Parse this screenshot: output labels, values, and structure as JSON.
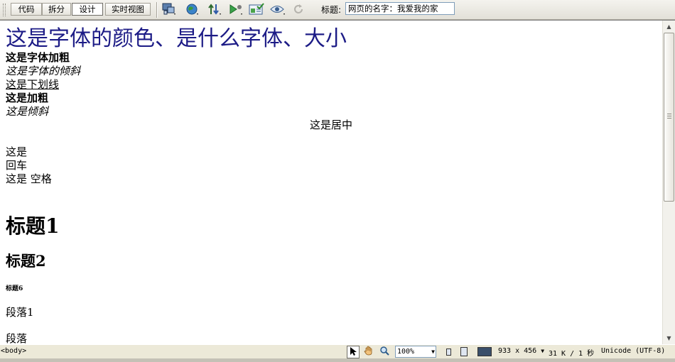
{
  "toolbar": {
    "code_label": "代码",
    "split_label": "拆分",
    "design_label": "设计",
    "live_view_label": "实时视图",
    "title_label": "标题:",
    "title_value": "网页的名字：我爱我的家",
    "icons": [
      "multiscreen-icon",
      "preview-browser-icon",
      "file-management-icon",
      "debug-icon",
      "visual-aids-icon",
      "view-options-icon",
      "refresh-icon"
    ]
  },
  "document": {
    "big_text": "这是字体的颜色、是什么字体、大小",
    "big_text_color": "#1c1b86",
    "bold_text": "这是字体加粗",
    "italic_text": "这是字体的倾斜",
    "underline_text": "这是下划线",
    "bold_text_2": "这是加粗",
    "italic_text_2": "这是倾斜",
    "center_text": "这是居中",
    "line_break_1": "这是",
    "line_break_2": "回车",
    "line_break_3": "这是 空格",
    "heading_1": "标题1",
    "heading_2": "标题2",
    "heading_6": "标题6",
    "paragraph_1": "段落1",
    "paragraph_2": "段落"
  },
  "statusbar": {
    "tag_selector": "<body>",
    "zoom": "100%",
    "window_size": "933 x 456",
    "download_info": "31 K / 1 秒",
    "encoding": "Unicode (UTF-8)"
  }
}
